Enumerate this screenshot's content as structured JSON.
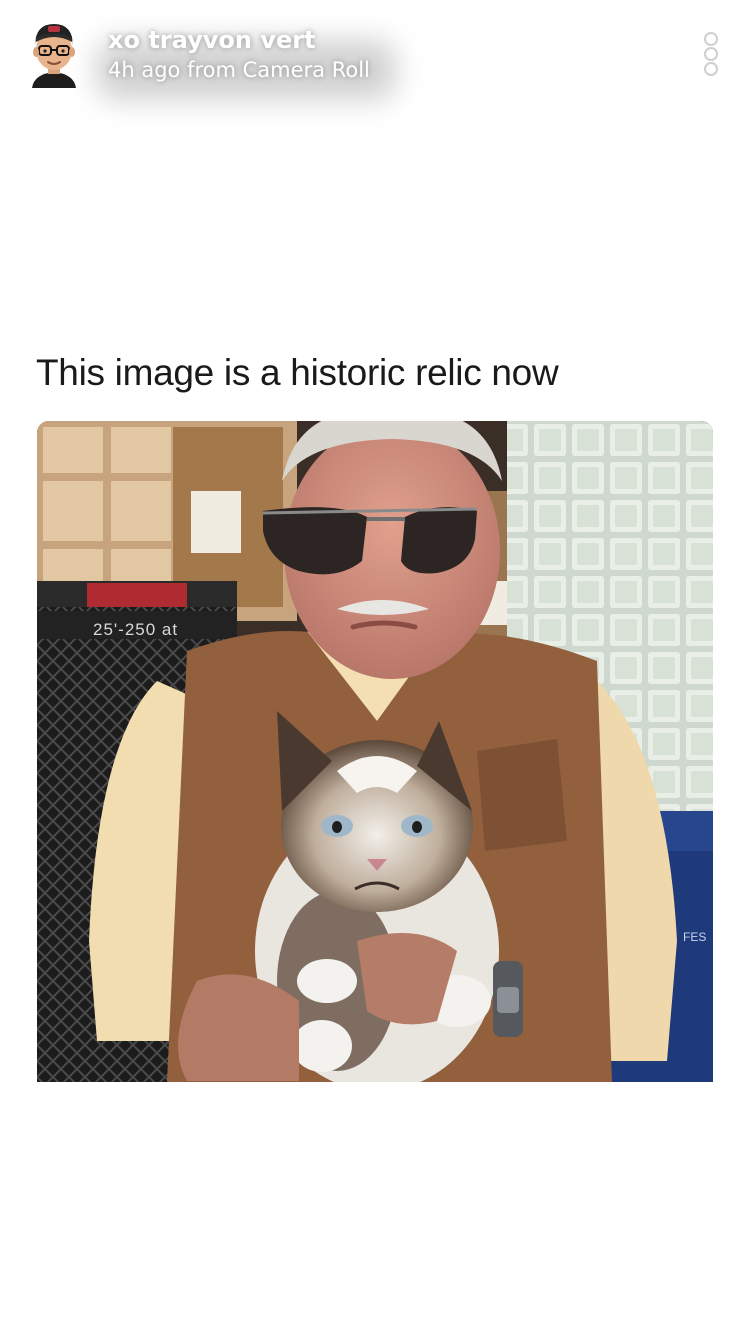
{
  "header": {
    "user_name": "xo trayvon vert",
    "timestamp": "4h ago from Camera Roll",
    "avatar_icon": "bitmoji-avatar-icon",
    "menu_icon": "more-options-icon"
  },
  "post": {
    "caption": "This image is a historic relic now",
    "photo": {
      "icon": "photo-image",
      "sign_text": "25'-250 at",
      "bin_text": "FES"
    }
  },
  "colors": {
    "background": "#ffffff",
    "caption_text": "#1a1a1a",
    "header_text": "#ffffff"
  }
}
